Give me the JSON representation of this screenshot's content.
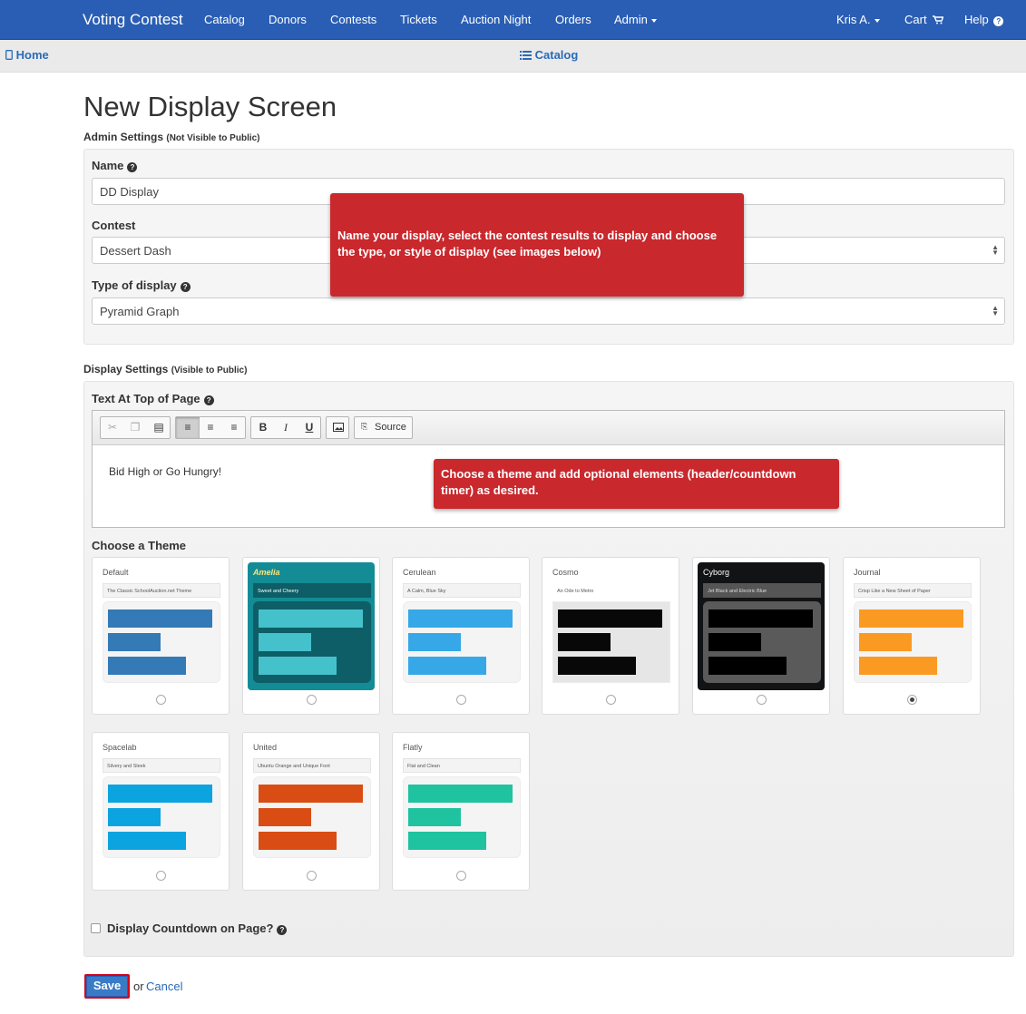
{
  "navbar": {
    "brand": "Voting Contest",
    "items": [
      "Catalog",
      "Donors",
      "Contests",
      "Tickets",
      "Auction Night",
      "Orders",
      "Admin"
    ],
    "user": "Kris A.",
    "cart": "Cart",
    "help": "Help"
  },
  "subnav": {
    "home": "Home",
    "catalog": "Catalog"
  },
  "page_title": "New Display Screen",
  "admin_settings": {
    "heading": "Admin Settings",
    "note": "(Not Visible to Public)",
    "name_label": "Name",
    "name_value": "DD Display",
    "contest_label": "Contest",
    "contest_value": "Dessert Dash",
    "type_label": "Type of display",
    "type_value": "Pyramid Graph"
  },
  "display_settings": {
    "heading": "Display Settings",
    "note": "(Visible to Public)",
    "text_label": "Text At Top of Page",
    "editor_text": "Bid High or Go Hungry!",
    "source_label": "Source",
    "theme_label": "Choose a Theme",
    "countdown_label": "Display Countdown on Page?"
  },
  "callouts": {
    "first": "Name your display, select the contest results to display and choose the type, or style of display (see images below)",
    "second": "Choose a theme and add optional elements (header/countdown timer) as desired."
  },
  "themes": [
    {
      "name": "Default",
      "tagline": "The Classic SchoolAuction.net Theme",
      "color": "#337ab7",
      "selected": false
    },
    {
      "name": "Amelia",
      "tagline": "Sweet and Cheery",
      "color": "#45c1cc",
      "selected": false
    },
    {
      "name": "Cerulean",
      "tagline": "A Calm, Blue Sky",
      "color": "#36a8e8",
      "selected": false
    },
    {
      "name": "Cosmo",
      "tagline": "An Ode to Metro",
      "color": "#080808",
      "selected": false
    },
    {
      "name": "Cyborg",
      "tagline": "Jet Black and Electric Blue",
      "color": "#000000",
      "selected": false
    },
    {
      "name": "Journal",
      "tagline": "Crisp Like a New Sheet of Paper",
      "color": "#fb9a23",
      "selected": true
    },
    {
      "name": "Spacelab",
      "tagline": "Silvery and Sleek",
      "color": "#0ba3e0",
      "selected": false
    },
    {
      "name": "United",
      "tagline": "Ubuntu Orange and Unique Font",
      "color": "#d94d14",
      "selected": false
    },
    {
      "name": "Flatly",
      "tagline": "Flat and Clean",
      "color": "#1fc3a0",
      "selected": false
    }
  ],
  "actions": {
    "save": "Save",
    "or": "or",
    "cancel": "Cancel"
  }
}
